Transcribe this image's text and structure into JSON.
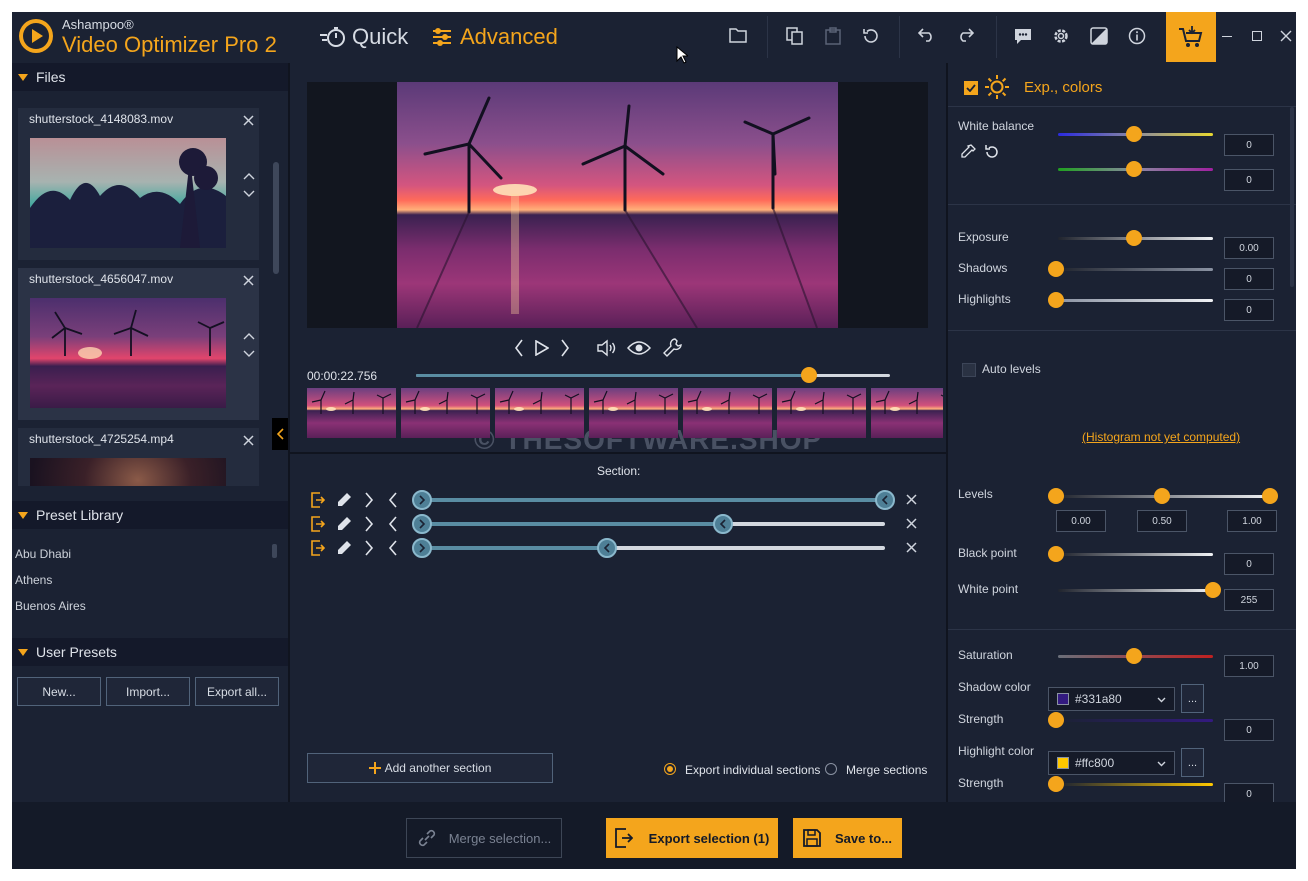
{
  "app": {
    "brand": "Ashampoo®",
    "name": "Video Optimizer Pro 2"
  },
  "modes": {
    "quick": "Quick",
    "advanced": "Advanced"
  },
  "files": {
    "header": "Files",
    "items": [
      {
        "name": "shutterstock_4148083.mov"
      },
      {
        "name": "shutterstock_4656047.mov"
      },
      {
        "name": "shutterstock_4725254.mp4"
      }
    ]
  },
  "presets": {
    "header": "Preset Library",
    "items": [
      "Abu Dhabi",
      "Athens",
      "Buenos Aires"
    ]
  },
  "user_presets": {
    "header": "User Presets",
    "new": "New...",
    "import": "Import...",
    "export": "Export all..."
  },
  "player": {
    "time": "00:00:22.756",
    "progress": 0.83
  },
  "watermark": "© THESOFTWARE.SHOP",
  "section": {
    "label": "Section:",
    "rows": [
      {
        "start": 0.0,
        "end": 1.0
      },
      {
        "start": 0.0,
        "end": 0.65
      },
      {
        "start": 0.0,
        "end": 0.4
      }
    ],
    "add_button": "Add another section",
    "export_individual": "Export individual sections",
    "merge_sections": "Merge sections"
  },
  "bottom": {
    "merge": "Merge selection...",
    "export": "Export selection (1)",
    "save": "Save to..."
  },
  "right": {
    "title": "Exp., colors",
    "white_balance": "White balance",
    "wb1": "0",
    "wb2": "0",
    "exposure": "Exposure",
    "exposure_val": "0.00",
    "shadows": "Shadows",
    "shadows_val": "0",
    "highlights": "Highlights",
    "highlights_val": "0",
    "auto_levels": "Auto levels",
    "histogram": "(Histogram not yet computed)",
    "levels": "Levels",
    "levels_low": "0.00",
    "levels_mid": "0.50",
    "levels_high": "1.00",
    "black_point": "Black point",
    "black_point_val": "0",
    "white_point": "White point",
    "white_point_val": "255",
    "saturation": "Saturation",
    "saturation_val": "1.00",
    "shadow_color": "Shadow color",
    "shadow_color_val": "#331a80",
    "strength": "Strength",
    "strength1_val": "0",
    "highlight_color": "Highlight color",
    "highlight_color_val": "#ffc800",
    "strength2_val": "0",
    "more": "..."
  },
  "colors": {
    "accent": "#f4a51c",
    "shadow_swatch": "#331a80",
    "highlight_swatch": "#ffc800"
  }
}
